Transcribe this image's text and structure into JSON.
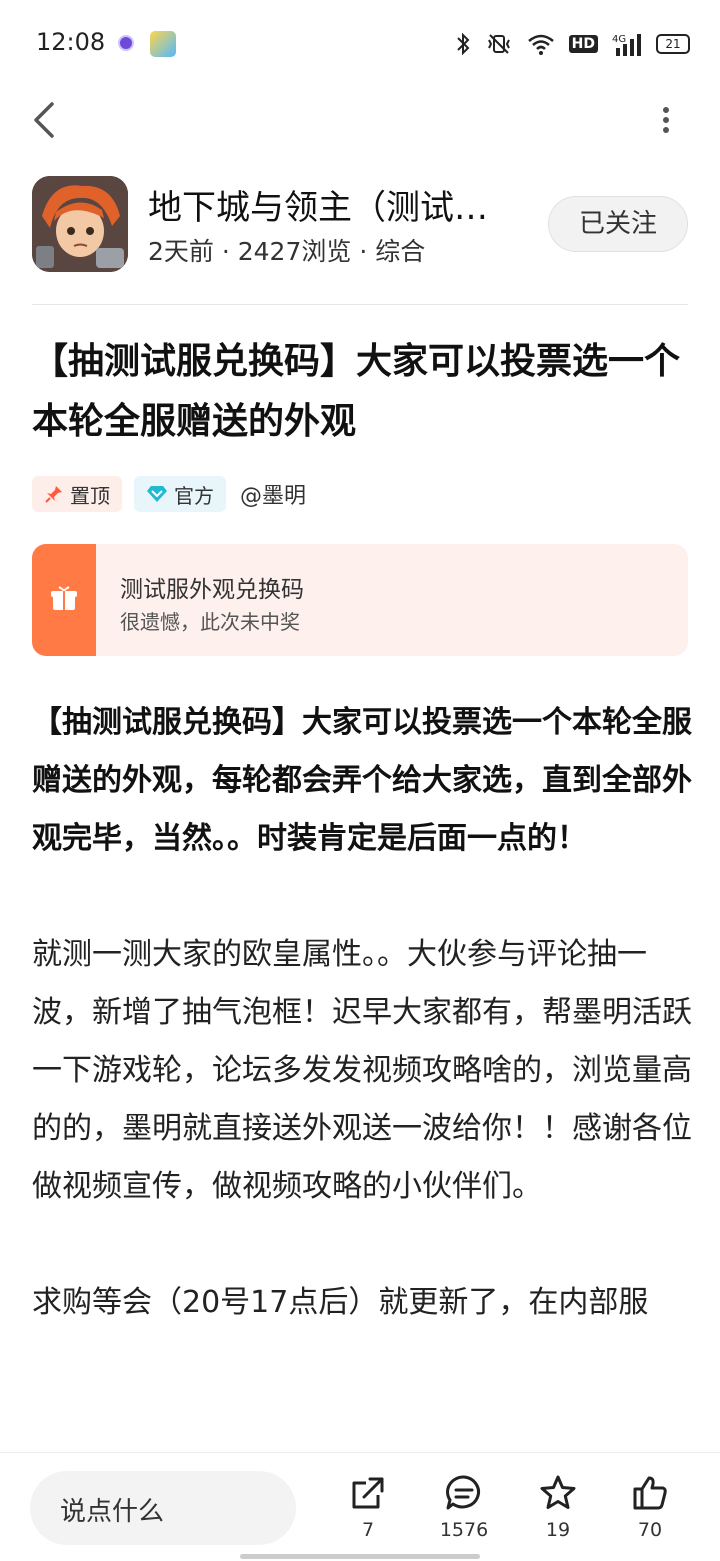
{
  "status_bar": {
    "time": "12:08",
    "network": "4G",
    "hd": "HD",
    "battery": "21",
    "icons": [
      "notification-dot-icon",
      "app-notification-icon",
      "bluetooth-icon",
      "vibrate-icon",
      "wifi-icon",
      "signal-icon",
      "battery-icon"
    ]
  },
  "nav": {
    "back_icon": "chevron-left-icon",
    "more_icon": "more-vertical-icon"
  },
  "game": {
    "title": "地下城与领主（测试…",
    "meta": "2天前 · 2427浏览 · 综合",
    "follow_label": "已关注"
  },
  "post": {
    "title": "【抽测试服兑换码】大家可以投票选一个本轮全服赠送的外观",
    "tags": {
      "pinned": "置顶",
      "official": "官方"
    },
    "author": "@墨明"
  },
  "reward_card": {
    "title": "测试服外观兑换码",
    "subtitle": "很遗憾，此次未中奖",
    "accent": "#ff7a45"
  },
  "body": {
    "p1": "【抽测试服兑换码】大家可以投票选一个本轮全服赠送的外观，每轮都会弄个给大家选，直到全部外观完毕，当然。。时装肯定是后面一点的！",
    "p2": "就测一测大家的欧皇属性。。大伙参与评论抽一波，新增了抽气泡框！迟早大家都有，帮墨明活跃一下游戏轮，论坛多发发视频攻略啥的，浏览量高的的，墨明就直接送外观送一波给你！！感谢各位做视频宣传，做视频攻略的小伙伴们。",
    "p3": "求购等会（20号17点后）就更新了，在内部服"
  },
  "bottom_bar": {
    "comment_placeholder": "说点什么",
    "share_count": "7",
    "comment_count": "1576",
    "favorite_count": "19",
    "like_count": "70"
  }
}
